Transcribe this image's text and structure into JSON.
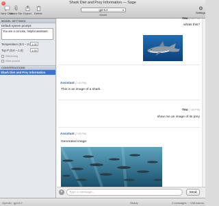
{
  "window": {
    "title": "Shark Diet and Prey Information — Sage"
  },
  "toolbar": {
    "new_chat_label": "New Chat",
    "attach_file_label": "Attach File",
    "export_label": "Export",
    "delete_label": "Delete",
    "model_value": "gpt-5.2",
    "model_label": "Model",
    "settings_label": "Settings"
  },
  "sidebar": {
    "model_settings_header": "MODEL SETTINGS",
    "system_prompt_label": "Default system prompt:",
    "system_prompt_value": "You are a concise, helpful assistant.",
    "temperature_label": "Temperature (0.0 – 2.0)",
    "temperature_value": "1.00",
    "top_p_label": "Top P (0.0 – 1.0)",
    "top_p_value": "1.00",
    "streaming_label": "Streaming",
    "web_search_label": "Web search",
    "conversations_header": "CONVERSATIONS",
    "conversations": [
      {
        "title": "Shark Diet and Prey Information"
      }
    ]
  },
  "chat": {
    "messages": [
      {
        "sender": "You",
        "time": "(7:49 PM)",
        "text": "whats this?",
        "image": "shark-photo"
      },
      {
        "sender": "Assistant",
        "time": "(7:49 PM)",
        "text": "This is an image of a shark."
      },
      {
        "sender": "You",
        "time": "(7:49 PM)",
        "text": "show me an image of its prey"
      },
      {
        "sender": "Assistant",
        "time": "(7:49 PM)",
        "text": "Generated image:",
        "image": "fish-school-image"
      }
    ]
  },
  "composer": {
    "placeholder": "Type a message...",
    "send_label": "Send"
  },
  "status": {
    "provider": "OpenAI · gpt-5.2",
    "state": "Ready",
    "summary": "2 messages · ~158 tokens"
  },
  "colors": {
    "accent": "#3d73cf",
    "assistant_name": "#2c5fb8"
  }
}
